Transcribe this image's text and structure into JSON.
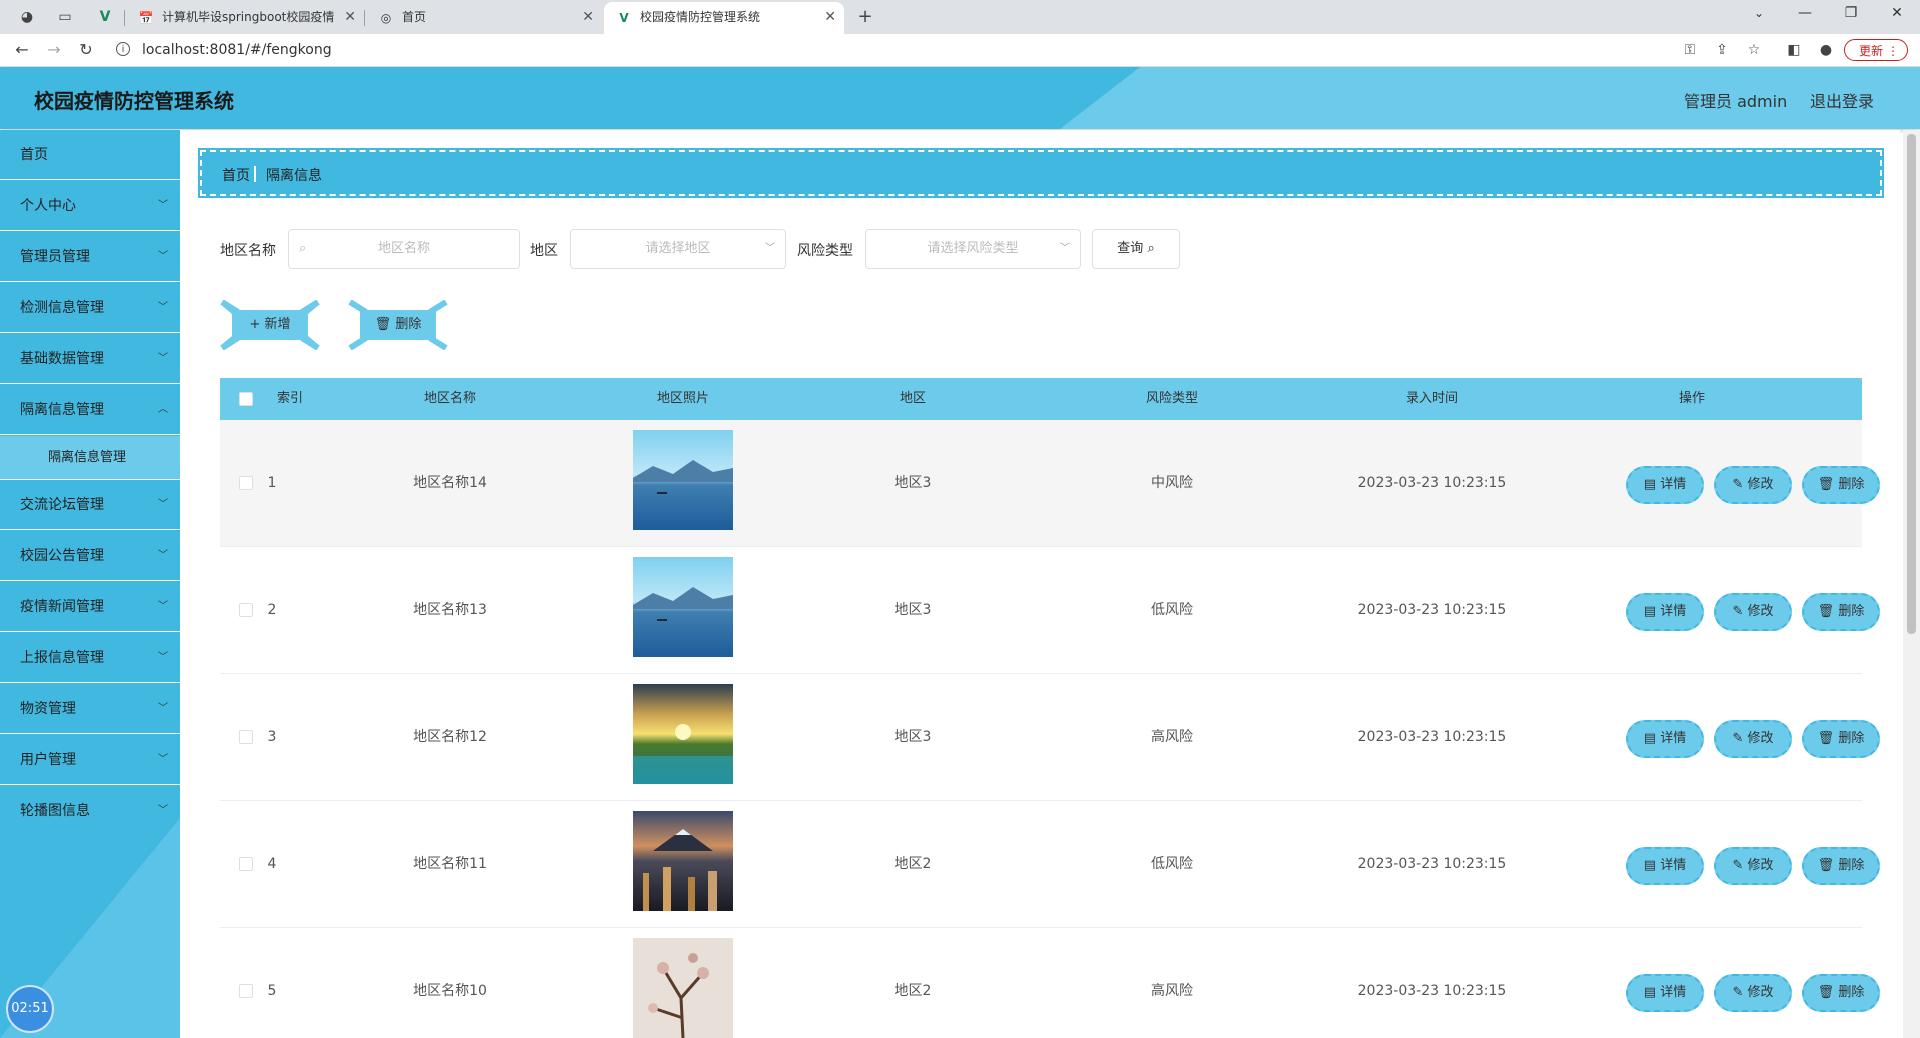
{
  "browser": {
    "tabs": [
      {
        "title": "计算机毕设springboot校园疫情"
      },
      {
        "title": "首页"
      },
      {
        "title": "校园疫情防控管理系统"
      }
    ],
    "url": "localhost:8081/#/fengkong",
    "update_label": "更新"
  },
  "header": {
    "title": "校园疫情防控管理系统",
    "user": "管理员 admin",
    "logout": "退出登录"
  },
  "sidebar": {
    "items": [
      {
        "label": "首页"
      },
      {
        "label": "个人中心"
      },
      {
        "label": "管理员管理"
      },
      {
        "label": "检测信息管理"
      },
      {
        "label": "基础数据管理"
      },
      {
        "label": "隔离信息管理"
      },
      {
        "label": "交流论坛管理"
      },
      {
        "label": "校园公告管理"
      },
      {
        "label": "疫情新闻管理"
      },
      {
        "label": "上报信息管理"
      },
      {
        "label": "物资管理"
      },
      {
        "label": "用户管理"
      },
      {
        "label": "轮播图信息"
      }
    ],
    "subitem": "隔离信息管理",
    "clock": "02:51"
  },
  "breadcrumb": {
    "home": "首页",
    "current": "隔离信息"
  },
  "filters": {
    "name_label": "地区名称",
    "name_placeholder": "地区名称",
    "area_label": "地区",
    "area_placeholder": "请选择地区",
    "risk_label": "风险类型",
    "risk_placeholder": "请选择风险类型",
    "query_label": "查询"
  },
  "actions": {
    "add": "+ 新增",
    "delete": "删除"
  },
  "table": {
    "headers": [
      "索引",
      "地区名称",
      "地区照片",
      "地区",
      "风险类型",
      "录入时间",
      "操作"
    ],
    "rows": [
      {
        "index": "1",
        "name": "地区名称14",
        "area": "地区3",
        "risk": "中风险",
        "time": "2023-03-23 10:23:15",
        "photo": "lake"
      },
      {
        "index": "2",
        "name": "地区名称13",
        "area": "地区3",
        "risk": "低风险",
        "time": "2023-03-23 10:23:15",
        "photo": "lake"
      },
      {
        "index": "3",
        "name": "地区名称12",
        "area": "地区3",
        "risk": "高风险",
        "time": "2023-03-23 10:23:15",
        "photo": "sunset"
      },
      {
        "index": "4",
        "name": "地区名称11",
        "area": "地区2",
        "risk": "低风险",
        "time": "2023-03-23 10:23:15",
        "photo": "city"
      },
      {
        "index": "5",
        "name": "地区名称10",
        "area": "地区2",
        "risk": "高风险",
        "time": "2023-03-23 10:23:15",
        "photo": "blossom"
      }
    ],
    "op_detail": "详情",
    "op_edit": "修改",
    "op_delete": "删除"
  },
  "colors": {
    "primary": "#41b8e0",
    "light": "#6ccaea"
  }
}
